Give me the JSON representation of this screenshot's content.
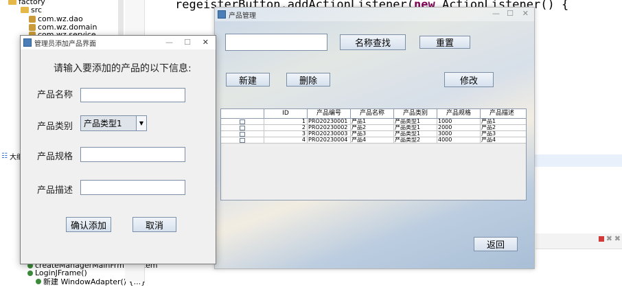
{
  "ide": {
    "tree": {
      "project": "factory",
      "src": "src",
      "packages": [
        "com.wz.dao",
        "com.wz.domain",
        "com.wz.service"
      ]
    },
    "code_line": {
      "part1": "regeisterButton.addActionListener(",
      "keyword": "new",
      "part2": " ActionListener() {"
    },
    "outline_label": "大纲",
    "outline_items": [
      "createManagerMainFrm(JSystem",
      "LoginJFrame()",
      "新建 WindowAdapter() {...}"
    ]
  },
  "product_window": {
    "title": "产品管理",
    "search_value": "",
    "buttons": {
      "search": "名称查找",
      "reset": "重置",
      "new": "新建",
      "delete": "删除",
      "edit": "修改",
      "back": "返回"
    },
    "table": {
      "columns": [
        "",
        "ID",
        "产品编号",
        "产品名称",
        "产品类别",
        "产品规格",
        "产品描述"
      ],
      "rows": [
        [
          "",
          "1",
          "PRO20230001",
          "产品1",
          "产品类型1",
          "1000",
          "产品1"
        ],
        [
          "",
          "2",
          "PRO20230002",
          "产品2",
          "产品类型1",
          "2000",
          "产品2"
        ],
        [
          "",
          "3",
          "PRO20230003",
          "产品3",
          "产品类型1",
          "3000",
          "产品3"
        ],
        [
          "",
          "4",
          "PRO20230004",
          "产品4",
          "产品类型2",
          "4000",
          "产品4"
        ]
      ]
    }
  },
  "add_dialog": {
    "title": "管理员添加产品界面",
    "heading": "请输入要添加的产品的以下信息:",
    "fields": {
      "name_label": "产品名称",
      "category_label": "产品类别",
      "category_value": "产品类型1",
      "spec_label": "产品规格",
      "desc_label": "产品描述"
    },
    "buttons": {
      "confirm": "确认添加",
      "cancel": "取消"
    }
  },
  "window_controls": {
    "minimize": "—",
    "maximize": "☐",
    "close": "✕"
  }
}
